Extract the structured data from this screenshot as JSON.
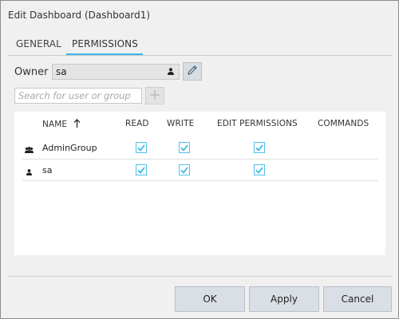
{
  "dialog": {
    "title": "Edit Dashboard (Dashboard1)"
  },
  "tabs": [
    {
      "label": "GENERAL",
      "active": false
    },
    {
      "label": "PERMISSIONS",
      "active": true
    }
  ],
  "owner": {
    "label": "Owner",
    "value": "sa",
    "icon": "person-icon",
    "edit_icon": "pencil-icon"
  },
  "search": {
    "placeholder": "Search for user or group",
    "value": "",
    "add_icon": "plus-icon"
  },
  "grid": {
    "columns": [
      "NAME",
      "READ",
      "WRITE",
      "EDIT PERMISSIONS",
      "COMMANDS"
    ],
    "sort_icon": "arrow-up-icon",
    "rows": [
      {
        "name": "AdminGroup",
        "icon": "group-icon",
        "read": true,
        "write": true,
        "edit_permissions": true,
        "commands": ""
      },
      {
        "name": "sa",
        "icon": "person-icon",
        "read": true,
        "write": true,
        "edit_permissions": true,
        "commands": ""
      }
    ]
  },
  "buttons": {
    "ok": "OK",
    "apply": "Apply",
    "cancel": "Cancel"
  },
  "colors": {
    "accent": "#3fb6e4",
    "checkbox_border": "#50c0e8",
    "button_bg": "#d9dfe5"
  }
}
